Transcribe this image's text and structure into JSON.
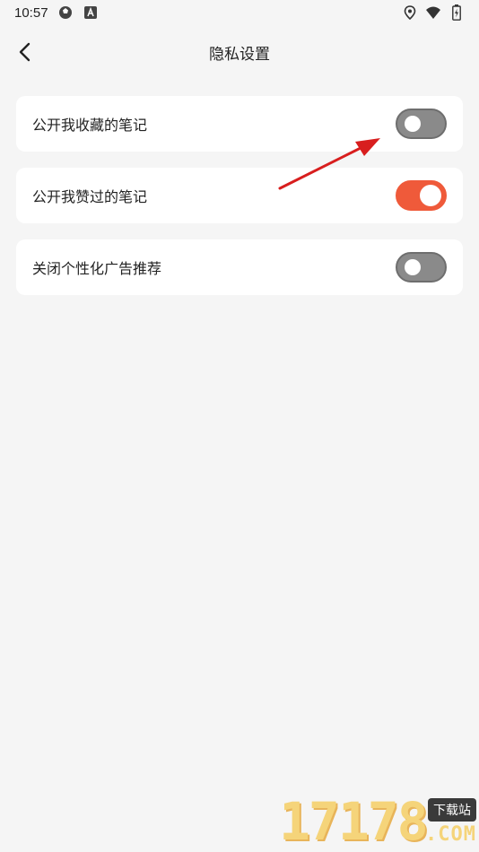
{
  "status_bar": {
    "time": "10:57",
    "icons_left": [
      "ball-icon",
      "a-badge-icon"
    ],
    "icons_right": [
      "location-icon",
      "wifi-icon",
      "battery-icon"
    ]
  },
  "header": {
    "title": "隐私设置",
    "back_icon": "chevron-left-icon"
  },
  "settings": [
    {
      "label": "公开我收藏的笔记",
      "enabled": false
    },
    {
      "label": "公开我赞过的笔记",
      "enabled": true
    },
    {
      "label": "关闭个性化广告推荐",
      "enabled": false
    }
  ],
  "annotation": {
    "type": "arrow",
    "color": "#e02020"
  },
  "watermark": {
    "digits": "17178",
    "tag": "下载站",
    "suffix": ".COM"
  },
  "colors": {
    "accent": "#ef5a3a",
    "toggle_off": "#8a8a8a",
    "background": "#f5f5f5",
    "card": "#ffffff"
  }
}
